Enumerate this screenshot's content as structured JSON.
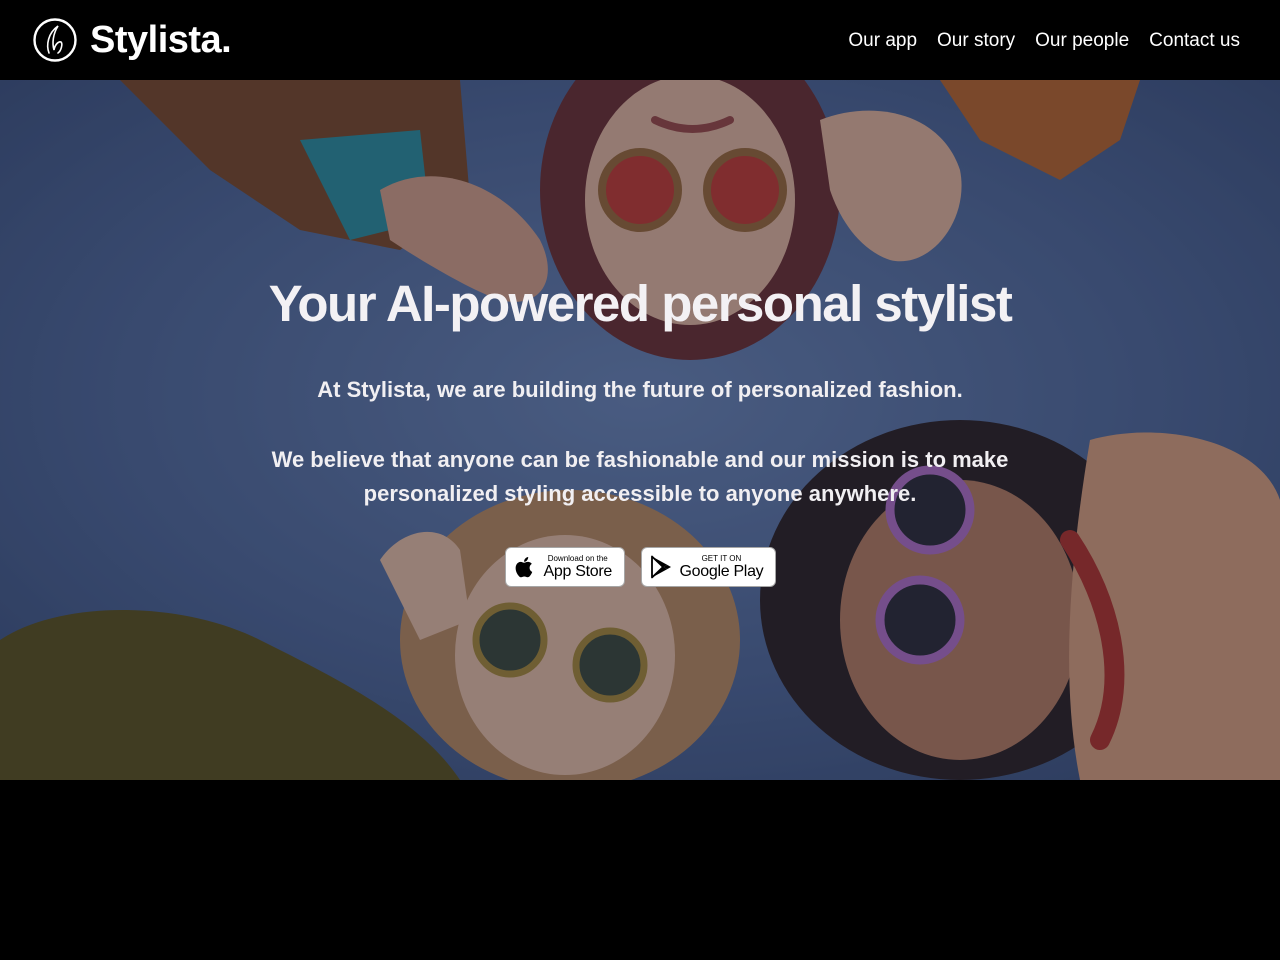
{
  "brand": {
    "name": "Stylista.",
    "logo_icon": "stylista-logo-icon"
  },
  "nav": {
    "items": [
      {
        "label": "Our app"
      },
      {
        "label": "Our story"
      },
      {
        "label": "Our people"
      },
      {
        "label": "Contact us"
      }
    ]
  },
  "hero": {
    "title": "Your AI-powered personal stylist",
    "subtitle": "At Stylista, we are building the future of personalized fashion.",
    "mission": "We believe that anyone can be fashionable and our mission is to make personalized styling accessible to anyone anywhere.",
    "background": "photo of four people in sunglasses looking down against a blue sky"
  },
  "badges": {
    "app_store": {
      "small": "Download on the",
      "big": "App Store",
      "icon": "apple-icon"
    },
    "google_play": {
      "small": "GET IT ON",
      "big": "Google Play",
      "icon": "google-play-icon"
    }
  },
  "colors": {
    "header_bg": "#000000",
    "sky": "#4d6796",
    "text": "#ffffff"
  }
}
